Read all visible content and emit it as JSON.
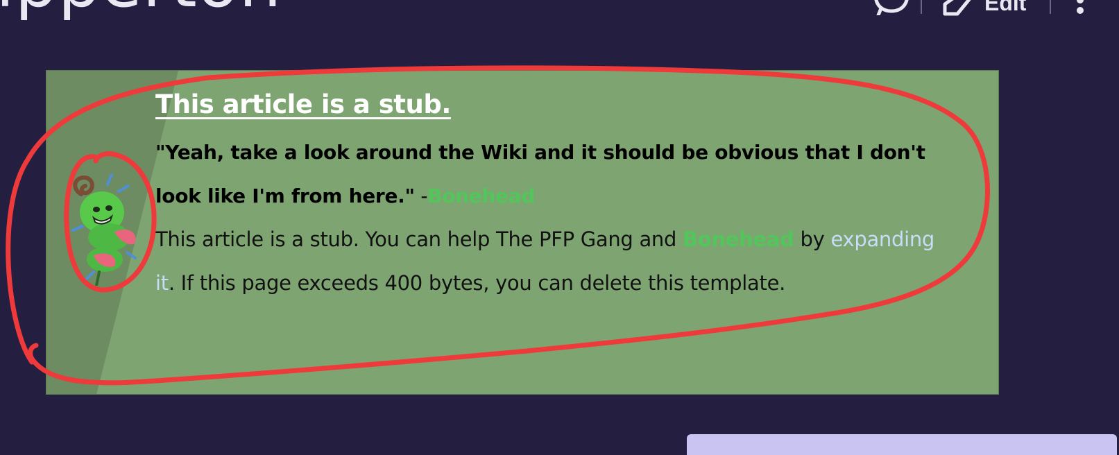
{
  "page": {
    "title_fragment": "ipperton",
    "edit_label": "Edit"
  },
  "stub": {
    "heading": "This article is a stub.",
    "quote_text": "\"Yeah, take a look around the Wiki and it should be obvious that I don't look like I'm from here.\"",
    "quote_dash": " -",
    "quote_author": "Bonehead",
    "body_part1": "This article is a stub. You can help The PFP Gang and ",
    "body_link1": "Bonehead",
    "body_part2": " by ",
    "body_link2": "expanding it",
    "body_part3": ". If this page exceeds 400 bytes, you can delete this template."
  },
  "colors": {
    "page_background": "#241f40",
    "stub_background": "#7ea472",
    "link_green": "#52c65a",
    "link_blue": "#c9dcf7",
    "annotation_red": "#ee3a3a"
  },
  "icons": {
    "talk": "speech-bubble-icon",
    "edit": "pencil-icon",
    "more": "vertical-ellipsis-icon",
    "mascot": "green-creature-mascot"
  }
}
